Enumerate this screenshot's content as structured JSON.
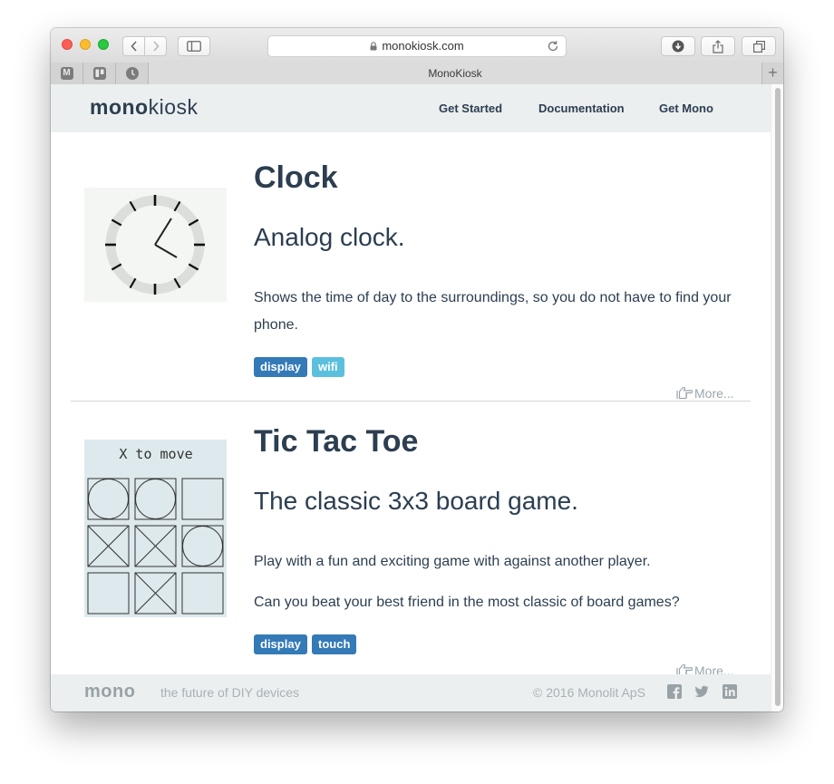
{
  "browser": {
    "url": "monokiosk.com",
    "tab_title": "MonoKiosk",
    "pinned_tabs": [
      {
        "icon": "monogram-m-icon",
        "glyph": "M"
      },
      {
        "icon": "trello-icon",
        "glyph": ""
      },
      {
        "icon": "clock-favicon-icon",
        "glyph": ""
      }
    ]
  },
  "header": {
    "brand_bold": "mono",
    "brand_light": "kiosk",
    "nav": [
      "Get Started",
      "Documentation",
      "Get Mono"
    ]
  },
  "apps": [
    {
      "title": "Clock",
      "subtitle": "Analog clock.",
      "description": [
        "Shows the time of day to the surroundings, so you do not have to find your phone."
      ],
      "tags": [
        "display",
        "wifi"
      ],
      "more": "More..."
    },
    {
      "title": "Tic Tac Toe",
      "subtitle": "The classic 3x3 board game.",
      "description": [
        "Play with a fun and exciting game with against another player.",
        "Can you beat your best friend in the most classic of board games?"
      ],
      "tags": [
        "display",
        "touch"
      ],
      "more": "More...",
      "screen_text": "X to move",
      "board": [
        "O",
        "O",
        "",
        "X",
        "X",
        "O",
        "",
        "X",
        ""
      ]
    }
  ],
  "footer": {
    "logo": "mono",
    "tagline": "the future of DIY devices",
    "copyright": "© 2016 Monolit ApS",
    "social": [
      "facebook-icon",
      "twitter-icon",
      "linkedin-icon"
    ]
  },
  "colors": {
    "text": "#2c3e50",
    "tag_primary": "#337ab7",
    "tag_info": "#5bc0de",
    "header_bg": "#ebeff0"
  }
}
